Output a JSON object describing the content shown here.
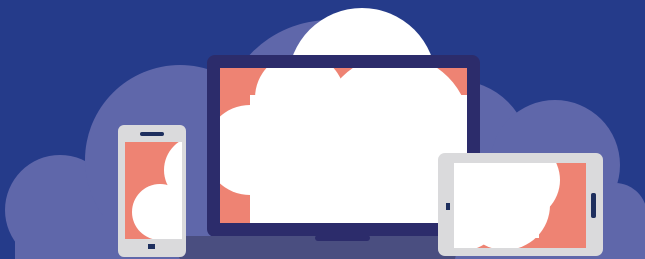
{
  "illustration": {
    "subject": "cloud-devices",
    "elements": [
      "cloud",
      "laptop",
      "smartphone",
      "tablet"
    ]
  },
  "colors": {
    "background": "#253B8A",
    "cloud": "#5F67AA",
    "cloud_highlight": "#FFFFFF",
    "laptop_bezel": "#2C2C6B",
    "laptop_base": "#4A4E80",
    "device_frame": "#DADADC",
    "screen_accent": "#EE8373",
    "screen_white": "#FFFFFF",
    "device_detail": "#1E2F5E"
  }
}
